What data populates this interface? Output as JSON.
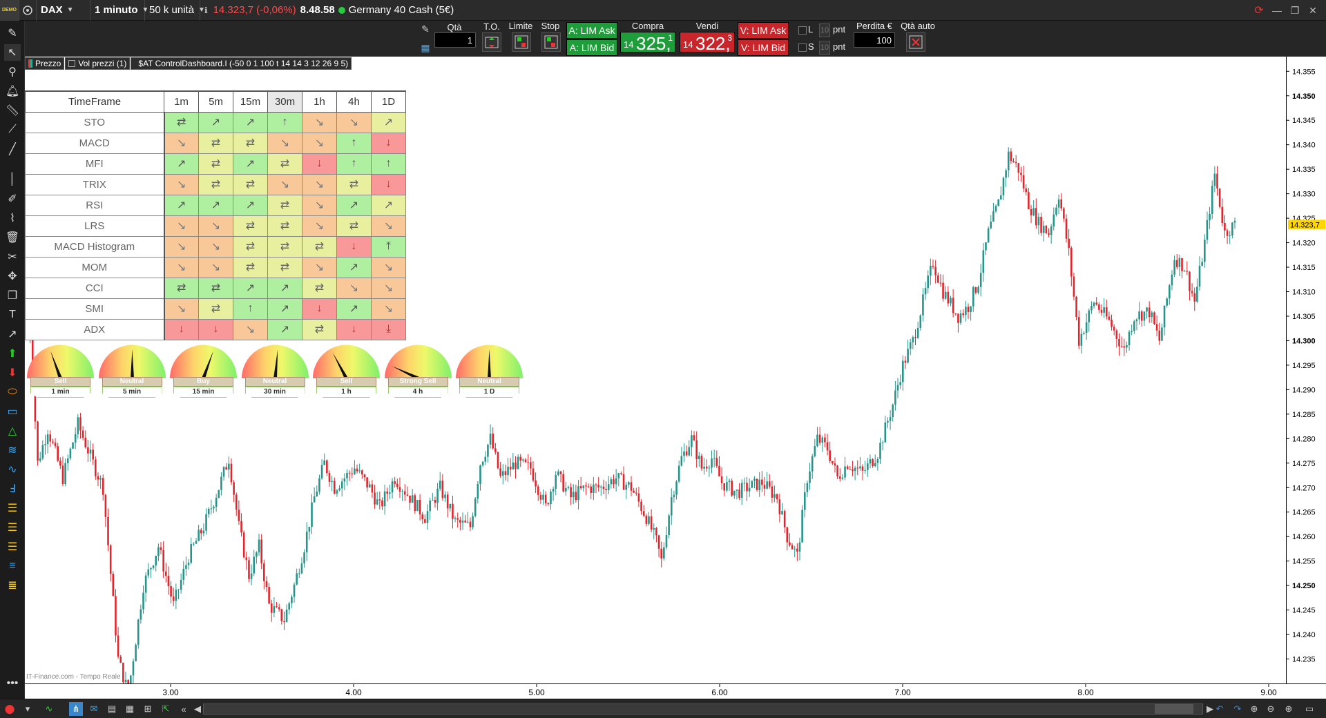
{
  "topbar": {
    "logo_text": "DEMO",
    "instrument": "DAX",
    "timeframe": "1 minuto",
    "units": "50 k unità",
    "info_icon": "ℹ",
    "last_price": "14.323,7 (-0,06%)",
    "time": "8.48.58",
    "instrument_name": "Germany 40 Cash (5€)"
  },
  "order": {
    "qty_label": "Qtà",
    "qty_value": "1",
    "to_label": "T.O.",
    "limit_label": "Limite",
    "stop_label": "Stop",
    "buy_ask": "A: LIM Ask",
    "buy_bid": "A: LIM Bid",
    "buy_label": "Compra",
    "buy_small": "14",
    "buy_big": "325,",
    "buy_sup": "1",
    "sell_label": "Vendi",
    "sell_small": "14",
    "sell_big": "322,",
    "sell_sup": "3",
    "sell_ask": "V: LIM Ask",
    "sell_bid": "V: LIM Bid",
    "l_label": "L",
    "s_label": "S",
    "l_pnt": "10",
    "s_pnt": "10",
    "pnt": "pnt",
    "loss_label": "Perdita €",
    "loss_value": "100",
    "auto_qty_label": "Qtà auto"
  },
  "legend": {
    "price": "Prezzo",
    "volume": "Vol prezzi (1)",
    "indicator": "$AT ControlDashboard.I (-50 0 1 100 t 14 14 3 12 26 9 5)"
  },
  "dashboard": {
    "header": "TimeFrame",
    "timeframes": [
      "1m",
      "5m",
      "15m",
      "30m",
      "1h",
      "4h",
      "1D"
    ],
    "rows": [
      {
        "name": "STO",
        "cells": [
          [
            "⇄",
            "lg"
          ],
          [
            "↗",
            "lg"
          ],
          [
            "↗",
            "lg"
          ],
          [
            "↑",
            "lg"
          ],
          [
            "↘",
            "o"
          ],
          [
            "↘",
            "o"
          ],
          [
            "↗",
            "y"
          ]
        ]
      },
      {
        "name": "MACD",
        "cells": [
          [
            "↘",
            "o"
          ],
          [
            "⇄",
            "y"
          ],
          [
            "⇄",
            "y"
          ],
          [
            "↘",
            "o"
          ],
          [
            "↘",
            "o"
          ],
          [
            "↑",
            "lg"
          ],
          [
            "↓",
            "r"
          ]
        ]
      },
      {
        "name": "MFI",
        "cells": [
          [
            "↗",
            "lg"
          ],
          [
            "⇄",
            "y"
          ],
          [
            "↗",
            "lg"
          ],
          [
            "⇄",
            "y"
          ],
          [
            "↓",
            "r"
          ],
          [
            "↑",
            "lg"
          ],
          [
            "↑",
            "lg"
          ]
        ]
      },
      {
        "name": "TRIX",
        "cells": [
          [
            "↘",
            "o"
          ],
          [
            "⇄",
            "y"
          ],
          [
            "⇄",
            "y"
          ],
          [
            "↘",
            "o"
          ],
          [
            "↘",
            "o"
          ],
          [
            "⇄",
            "y"
          ],
          [
            "↓",
            "r"
          ]
        ]
      },
      {
        "name": "RSI",
        "cells": [
          [
            "↗",
            "lg"
          ],
          [
            "↗",
            "lg"
          ],
          [
            "↗",
            "lg"
          ],
          [
            "⇄",
            "y"
          ],
          [
            "↘",
            "o"
          ],
          [
            "↗",
            "lg"
          ],
          [
            "↗",
            "y"
          ]
        ]
      },
      {
        "name": "LRS",
        "cells": [
          [
            "↘",
            "o"
          ],
          [
            "↘",
            "o"
          ],
          [
            "⇄",
            "y"
          ],
          [
            "⇄",
            "y"
          ],
          [
            "↘",
            "o"
          ],
          [
            "⇄",
            "y"
          ],
          [
            "↘",
            "o"
          ]
        ]
      },
      {
        "name": "MACD Histogram",
        "cells": [
          [
            "↘",
            "o"
          ],
          [
            "↘",
            "o"
          ],
          [
            "⇄",
            "y"
          ],
          [
            "⇄",
            "y"
          ],
          [
            "⇄",
            "y"
          ],
          [
            "↓",
            "r"
          ],
          [
            "⤒",
            "lg"
          ]
        ]
      },
      {
        "name": "MOM",
        "cells": [
          [
            "↘",
            "o"
          ],
          [
            "↘",
            "o"
          ],
          [
            "⇄",
            "y"
          ],
          [
            "⇄",
            "y"
          ],
          [
            "↘",
            "o"
          ],
          [
            "↗",
            "lg"
          ],
          [
            "↘",
            "o"
          ]
        ]
      },
      {
        "name": "CCI",
        "cells": [
          [
            "⇄",
            "lg"
          ],
          [
            "⇄",
            "lg"
          ],
          [
            "↗",
            "lg"
          ],
          [
            "↗",
            "lg"
          ],
          [
            "⇄",
            "y"
          ],
          [
            "↘",
            "o"
          ],
          [
            "↘",
            "o"
          ]
        ]
      },
      {
        "name": "SMI",
        "cells": [
          [
            "↘",
            "o"
          ],
          [
            "⇄",
            "y"
          ],
          [
            "↑",
            "lg"
          ],
          [
            "↗",
            "lg"
          ],
          [
            "↓",
            "r"
          ],
          [
            "↗",
            "lg"
          ],
          [
            "↘",
            "o"
          ]
        ]
      },
      {
        "name": "ADX",
        "cells": [
          [
            "↓",
            "r"
          ],
          [
            "↓",
            "r"
          ],
          [
            "↘",
            "o"
          ],
          [
            "↗",
            "lg"
          ],
          [
            "⇄",
            "y"
          ],
          [
            "↓",
            "r"
          ],
          [
            "⤓",
            "r"
          ]
        ]
      }
    ]
  },
  "gauges": [
    {
      "signal": "Sell",
      "tf": "1 min",
      "angle": -20
    },
    {
      "signal": "Neutral",
      "tf": "5 min",
      "angle": 0
    },
    {
      "signal": "Buy",
      "tf": "15 min",
      "angle": 20
    },
    {
      "signal": "Neutral",
      "tf": "30 min",
      "angle": 5
    },
    {
      "signal": "Sell",
      "tf": "1 h",
      "angle": -28
    },
    {
      "signal": "Strong Sell",
      "tf": "4 h",
      "angle": -65
    },
    {
      "signal": "Neutral",
      "tf": "1 D",
      "angle": 0
    }
  ],
  "watermark": "IT-Finance.com - Tempo Reale",
  "chart_data": {
    "type": "candlestick",
    "title": "DAX",
    "ylim": [
      14230,
      14358
    ],
    "y_ticks": [
      14355,
      14350,
      14345,
      14340,
      14335,
      14330,
      14325,
      14320,
      14315,
      14310,
      14305,
      14300,
      14295,
      14290,
      14285,
      14280,
      14275,
      14270,
      14265,
      14260,
      14255,
      14250,
      14245,
      14240,
      14235
    ],
    "y_tick_labels": [
      "14.355",
      "14.350",
      "14.345",
      "14.340",
      "14.335",
      "14.330",
      "14.325",
      "14.320",
      "14.315",
      "14.310",
      "14.305",
      "14.300",
      "14.295",
      "14.290",
      "14.285",
      "14.280",
      "14.275",
      "14.270",
      "14.265",
      "14.260",
      "14.255",
      "14.250",
      "14.245",
      "14.240",
      "14.235"
    ],
    "bold_ticks": [
      "14.350",
      "14.300",
      "14.250"
    ],
    "x_labels": [
      "3.00",
      "4.00",
      "5.00",
      "6.00",
      "7.00",
      "8.00",
      "9.00"
    ],
    "last_price_label": "14.323,7",
    "last_price": 14323.7,
    "close_path": [
      [
        0,
        14310
      ],
      [
        4,
        14275
      ],
      [
        8,
        14282
      ],
      [
        14,
        14272
      ],
      [
        20,
        14283
      ],
      [
        26,
        14275
      ],
      [
        30,
        14270
      ],
      [
        36,
        14235
      ],
      [
        40,
        14228
      ],
      [
        46,
        14250
      ],
      [
        52,
        14258
      ],
      [
        58,
        14246
      ],
      [
        64,
        14256
      ],
      [
        70,
        14262
      ],
      [
        76,
        14270
      ],
      [
        80,
        14276
      ],
      [
        84,
        14262
      ],
      [
        88,
        14252
      ],
      [
        92,
        14258
      ],
      [
        96,
        14246
      ],
      [
        102,
        14243
      ],
      [
        106,
        14250
      ],
      [
        110,
        14258
      ],
      [
        114,
        14268
      ],
      [
        118,
        14275
      ],
      [
        122,
        14270
      ],
      [
        126,
        14272
      ],
      [
        130,
        14274
      ],
      [
        136,
        14270
      ],
      [
        140,
        14266
      ],
      [
        146,
        14272
      ],
      [
        152,
        14268
      ],
      [
        158,
        14264
      ],
      [
        164,
        14270
      ],
      [
        170,
        14263
      ],
      [
        176,
        14262
      ],
      [
        180,
        14275
      ],
      [
        184,
        14280
      ],
      [
        188,
        14272
      ],
      [
        194,
        14275
      ],
      [
        200,
        14274
      ],
      [
        206,
        14266
      ],
      [
        210,
        14273
      ],
      [
        216,
        14268
      ],
      [
        222,
        14270
      ],
      [
        228,
        14270
      ],
      [
        234,
        14272
      ],
      [
        240,
        14270
      ],
      [
        246,
        14264
      ],
      [
        250,
        14259
      ],
      [
        252,
        14255
      ],
      [
        256,
        14268
      ],
      [
        260,
        14276
      ],
      [
        264,
        14280
      ],
      [
        268,
        14274
      ],
      [
        272,
        14276
      ],
      [
        276,
        14271
      ],
      [
        282,
        14269
      ],
      [
        286,
        14270
      ],
      [
        292,
        14271
      ],
      [
        298,
        14268
      ],
      [
        302,
        14260
      ],
      [
        306,
        14256
      ],
      [
        310,
        14272
      ],
      [
        314,
        14280
      ],
      [
        318,
        14278
      ],
      [
        322,
        14272
      ],
      [
        326,
        14275
      ],
      [
        332,
        14273
      ],
      [
        338,
        14277
      ],
      [
        344,
        14287
      ],
      [
        348,
        14295
      ],
      [
        352,
        14300
      ],
      [
        356,
        14308
      ],
      [
        360,
        14316
      ],
      [
        364,
        14310
      ],
      [
        370,
        14305
      ],
      [
        374,
        14307
      ],
      [
        378,
        14312
      ],
      [
        382,
        14322
      ],
      [
        386,
        14328
      ],
      [
        390,
        14338
      ],
      [
        394,
        14335
      ],
      [
        398,
        14328
      ],
      [
        402,
        14324
      ],
      [
        406,
        14322
      ],
      [
        410,
        14330
      ],
      [
        414,
        14318
      ],
      [
        418,
        14300
      ],
      [
        424,
        14308
      ],
      [
        430,
        14304
      ],
      [
        436,
        14298
      ],
      [
        440,
        14305
      ],
      [
        446,
        14306
      ],
      [
        450,
        14300
      ],
      [
        456,
        14317
      ],
      [
        460,
        14315
      ],
      [
        464,
        14308
      ],
      [
        468,
        14320
      ],
      [
        472,
        14334
      ],
      [
        476,
        14322
      ],
      [
        480,
        14323.7
      ]
    ]
  }
}
